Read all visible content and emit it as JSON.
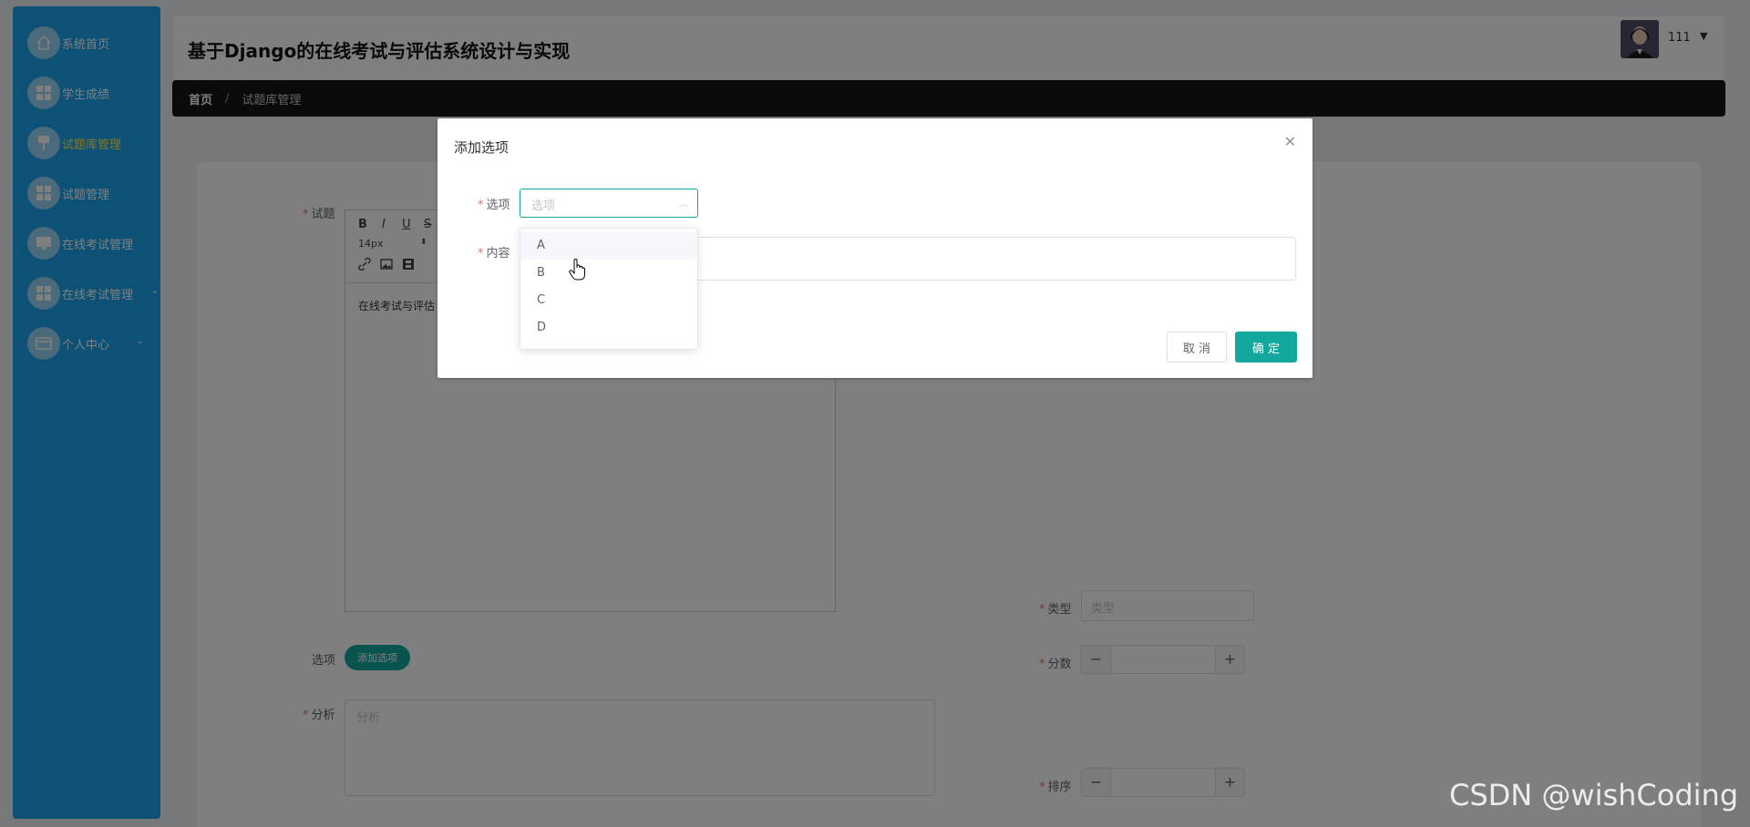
{
  "app_title": "基于Django的在线考试与评估系统设计与实现",
  "user": {
    "name": "111"
  },
  "sidebar": {
    "items": [
      {
        "label": "系统首页",
        "icon": "home-icon"
      },
      {
        "label": "学生成绩",
        "icon": "grid-icon"
      },
      {
        "label": "试题库管理",
        "icon": "pin-icon",
        "active": true
      },
      {
        "label": "试题管理",
        "icon": "grid-icon"
      },
      {
        "label": "在线考试管理",
        "icon": "monitor-icon"
      },
      {
        "label": "在线考试管理",
        "icon": "grid-icon",
        "has_chevron": true
      },
      {
        "label": "个人中心",
        "icon": "card-icon",
        "has_chevron": true
      }
    ]
  },
  "breadcrumb": {
    "home": "首页",
    "separator": "/",
    "current": "试题库管理"
  },
  "form": {
    "question_label": "试题",
    "font_size": "14px",
    "editor_text": "在线考试与评估",
    "options_label": "选项",
    "add_option_button": "添加选项",
    "analysis_label": "分析",
    "analysis_placeholder": "分析",
    "type_label": "类型",
    "type_placeholder": "类型",
    "score_label": "分数",
    "sort_label": "排序"
  },
  "dialog": {
    "title": "添加选项",
    "option_label": "选项",
    "option_placeholder": "选项",
    "content_label": "内容",
    "cancel_button": "取 消",
    "confirm_button": "确 定",
    "dropdown_options": [
      "A",
      "B",
      "C",
      "D"
    ]
  },
  "watermark": "CSDN @wishCoding",
  "colors": {
    "sidebar": "#1aa3ee",
    "accent": "#13a89e",
    "active_menu": "#ffef5a",
    "breadcrumb_bg": "#141414"
  }
}
